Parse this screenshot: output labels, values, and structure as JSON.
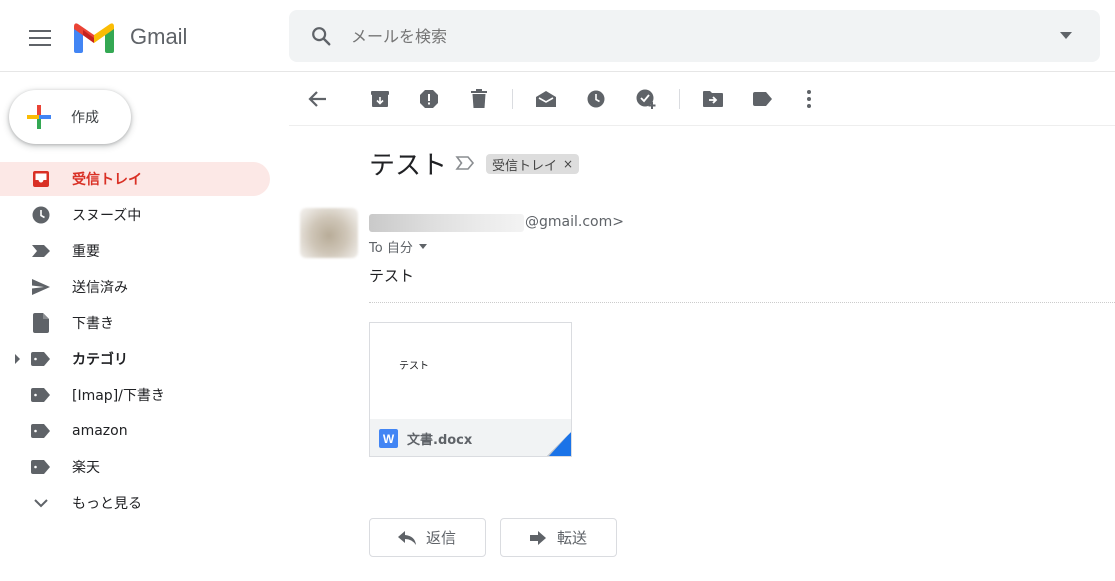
{
  "header": {
    "app_name": "Gmail",
    "search_placeholder": "メールを検索"
  },
  "compose": {
    "label": "作成"
  },
  "sidebar": {
    "items": [
      {
        "label": "受信トレイ",
        "icon": "inbox-icon"
      },
      {
        "label": "スヌーズ中",
        "icon": "clock-icon"
      },
      {
        "label": "重要",
        "icon": "important-icon"
      },
      {
        "label": "送信済み",
        "icon": "send-icon"
      },
      {
        "label": "下書き",
        "icon": "draft-icon"
      },
      {
        "label": "カテゴリ",
        "icon": "label-icon"
      },
      {
        "label": "[Imap]/下書き",
        "icon": "label-icon"
      },
      {
        "label": "amazon",
        "icon": "label-icon"
      },
      {
        "label": "楽天",
        "icon": "label-icon"
      },
      {
        "label": "もっと見る",
        "icon": "chevron-down-icon"
      }
    ]
  },
  "message": {
    "subject": "テスト",
    "label_chip": "受信トレイ",
    "label_close": "×",
    "sender_email_suffix": "@gmail.com>",
    "to_line": "To 自分",
    "body": "テスト"
  },
  "attachment": {
    "preview_text": "テスト",
    "icon_letter": "W",
    "file_name": "文書.docx"
  },
  "actions": {
    "reply": "返信",
    "forward": "転送"
  },
  "colors": {
    "accent_red": "#d93025",
    "active_bg": "#fce8e6",
    "icon_gray": "#5f6368"
  }
}
